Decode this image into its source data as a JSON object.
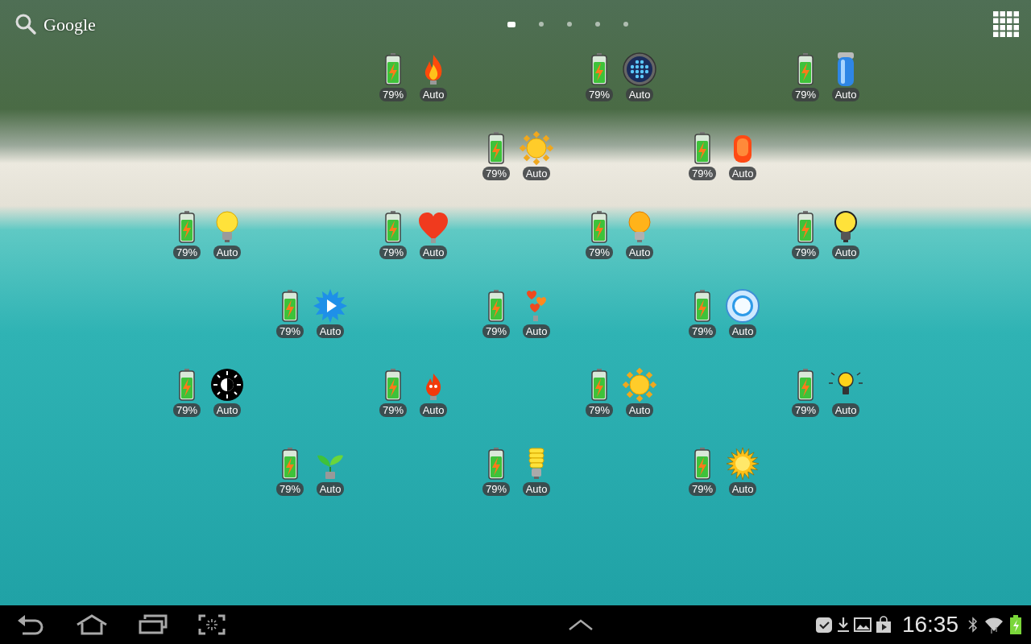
{
  "search": {
    "label": "Google"
  },
  "page_indicator": [
    {
      "selected": true
    },
    {
      "selected": false
    },
    {
      "selected": false
    },
    {
      "selected": false
    },
    {
      "selected": false
    }
  ],
  "widgets": [
    {
      "charge": "79%",
      "mode": "Auto"
    },
    {
      "charge": "79%",
      "mode": "Auto"
    },
    {
      "charge": "79%",
      "mode": "Auto"
    },
    {
      "charge": "79%",
      "mode": "Auto"
    },
    {
      "charge": "79%",
      "mode": "Auto"
    },
    {
      "charge": "79%",
      "mode": "Auto"
    },
    {
      "charge": "79%",
      "mode": "Auto"
    },
    {
      "charge": "79%",
      "mode": "Auto"
    },
    {
      "charge": "79%",
      "mode": "Auto"
    },
    {
      "charge": "79%",
      "mode": "Auto"
    },
    {
      "charge": "79%",
      "mode": "Auto"
    },
    {
      "charge": "79%",
      "mode": "Auto"
    },
    {
      "charge": "79%",
      "mode": "Auto"
    },
    {
      "charge": "79%",
      "mode": "Auto"
    },
    {
      "charge": "79%",
      "mode": "Auto"
    },
    {
      "charge": "79%",
      "mode": "Auto"
    },
    {
      "charge": "79%",
      "mode": "Auto"
    },
    {
      "charge": "79%",
      "mode": "Auto"
    },
    {
      "charge": "79%",
      "mode": "Auto"
    }
  ],
  "status_bar": {
    "time": "16:35"
  }
}
